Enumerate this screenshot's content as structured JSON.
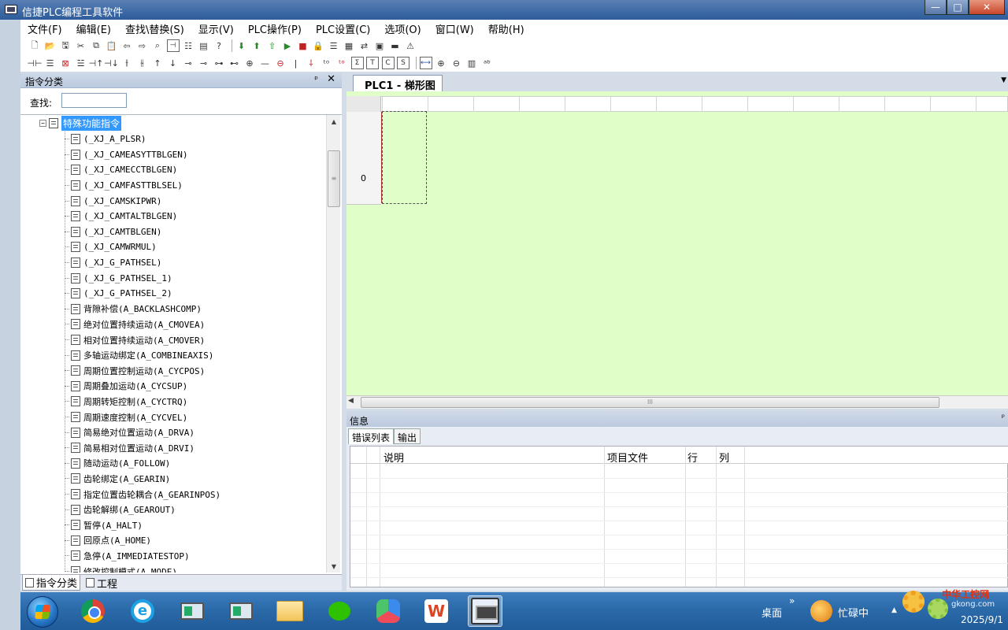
{
  "window": {
    "title": "信捷PLC编程工具软件",
    "controls": {
      "minimize": "—",
      "maximize": "□",
      "close": "✕"
    }
  },
  "menu": [
    "文件(F)",
    "编辑(E)",
    "查找\\替换(S)",
    "显示(V)",
    "PLC操作(P)",
    "PLC设置(C)",
    "选项(O)",
    "窗口(W)",
    "帮助(H)"
  ],
  "left_panel": {
    "title": "指令分类",
    "search_label": "查找:",
    "search_value": "",
    "root": {
      "label": "特殊功能指令",
      "expander": "−"
    },
    "items": [
      "(_XJ_A_PLSR)",
      "(_XJ_CAMEASYTTBLGEN)",
      "(_XJ_CAMECCTBLGEN)",
      "(_XJ_CAMFASTTBLSEL)",
      "(_XJ_CAMSKIPWR)",
      "(_XJ_CAMTALTBLGEN)",
      "(_XJ_CAMTBLGEN)",
      "(_XJ_CAMWRMUL)",
      "(_XJ_G_PATHSEL)",
      "(_XJ_G_PATHSEL_1)",
      "(_XJ_G_PATHSEL_2)",
      "背隙补偿(A_BACKLASHCOMP)",
      "绝对位置持续运动(A_CMOVEA)",
      "相对位置持续运动(A_CMOVER)",
      "多轴运动绑定(A_COMBINEAXIS)",
      "周期位置控制运动(A_CYCPOS)",
      "周期叠加运动(A_CYCSUP)",
      "周期转矩控制(A_CYCTRQ)",
      "周期速度控制(A_CYCVEL)",
      "简易绝对位置运动(A_DRVA)",
      "简易相对位置运动(A_DRVI)",
      "随动运动(A_FOLLOW)",
      "齿轮绑定(A_GEARIN)",
      "指定位置齿轮耦合(A_GEARINPOS)",
      "齿轮解绑(A_GEAROUT)",
      "暂停(A_HALT)",
      "回原点(A_HOME)",
      "急停(A_IMMEDIATESTOP)",
      "修改控制模式(A_MODE)"
    ],
    "bottom_tabs": [
      "指令分类",
      "工程"
    ]
  },
  "editor": {
    "tab": "PLC1 - 梯形图",
    "rung_number": "0",
    "scroll_grip": "III"
  },
  "info": {
    "title": "信息",
    "tabs": [
      "错误列表",
      "输出"
    ],
    "columns": [
      "说明",
      "项目文件",
      "行",
      "列"
    ]
  },
  "taskbar": {
    "desktop_label": "桌面",
    "expand_glyph": "»",
    "busy_label": "忙碌中",
    "clock": "2025/9/1",
    "watermark_title": "中华工控网",
    "watermark_url": "gkong.com"
  }
}
